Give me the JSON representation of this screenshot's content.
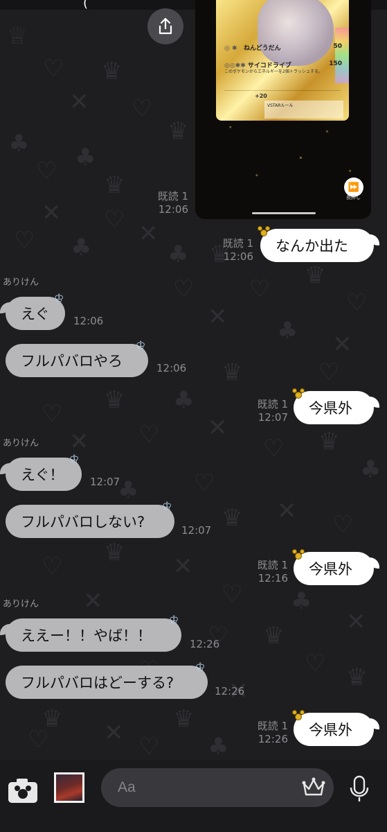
{
  "colors": {
    "background": "#1e1e20",
    "bubble_outgoing": "#ffffff",
    "bubble_incoming": "#b7b7ba",
    "meta_text": "#8d8d92",
    "input_bg": "#39393d"
  },
  "top_status_fragment": "(",
  "media_preview": {
    "card": {
      "name": "ねんどうだん",
      "damage1": "50",
      "attack_name": "サイコドライブ",
      "damage2": "150",
      "effect_text": "このポケモンからエネルギーを2個トラッシュする。",
      "weakness_mod": "+20",
      "vstar_label": "VSTARルール"
    },
    "skip_label": "長押し"
  },
  "messages": [
    {
      "id": "m1",
      "direction": "out",
      "read_label": "既読 1",
      "time": "12:06",
      "text": "なんか出た"
    },
    {
      "id": "m2",
      "direction": "in",
      "sender": "ありけん",
      "time": "12:06",
      "text": "えぐ"
    },
    {
      "id": "m3",
      "direction": "in",
      "time": "12:06",
      "text": "フルパバロやろ"
    },
    {
      "id": "m4",
      "direction": "out",
      "read_label": "既読 1",
      "time": "12:07",
      "text": "今県外"
    },
    {
      "id": "m5",
      "direction": "in",
      "sender": "ありけん",
      "time": "12:07",
      "text": "えぐ！"
    },
    {
      "id": "m6",
      "direction": "in",
      "time": "12:07",
      "text": "フルパバロしない?"
    },
    {
      "id": "m7",
      "direction": "out",
      "read_label": "既読 1",
      "time": "12:16",
      "text": "今県外"
    },
    {
      "id": "m8",
      "direction": "in",
      "sender": "ありけん",
      "time": "12:26",
      "text": "ええー！！やば！！"
    },
    {
      "id": "m9",
      "direction": "in",
      "time": "12:26",
      "text": "フルパバロはどーする?"
    },
    {
      "id": "m10",
      "direction": "out",
      "read_label": "既読 1",
      "time": "12:26",
      "text": "今県外"
    }
  ],
  "media_read": {
    "read_label": "既読 1",
    "time": "12:06"
  },
  "composer": {
    "placeholder": "Aa",
    "icons": [
      "camera-icon",
      "sticker-thumbnail",
      "crown-emoji-icon",
      "microphone-icon"
    ]
  }
}
